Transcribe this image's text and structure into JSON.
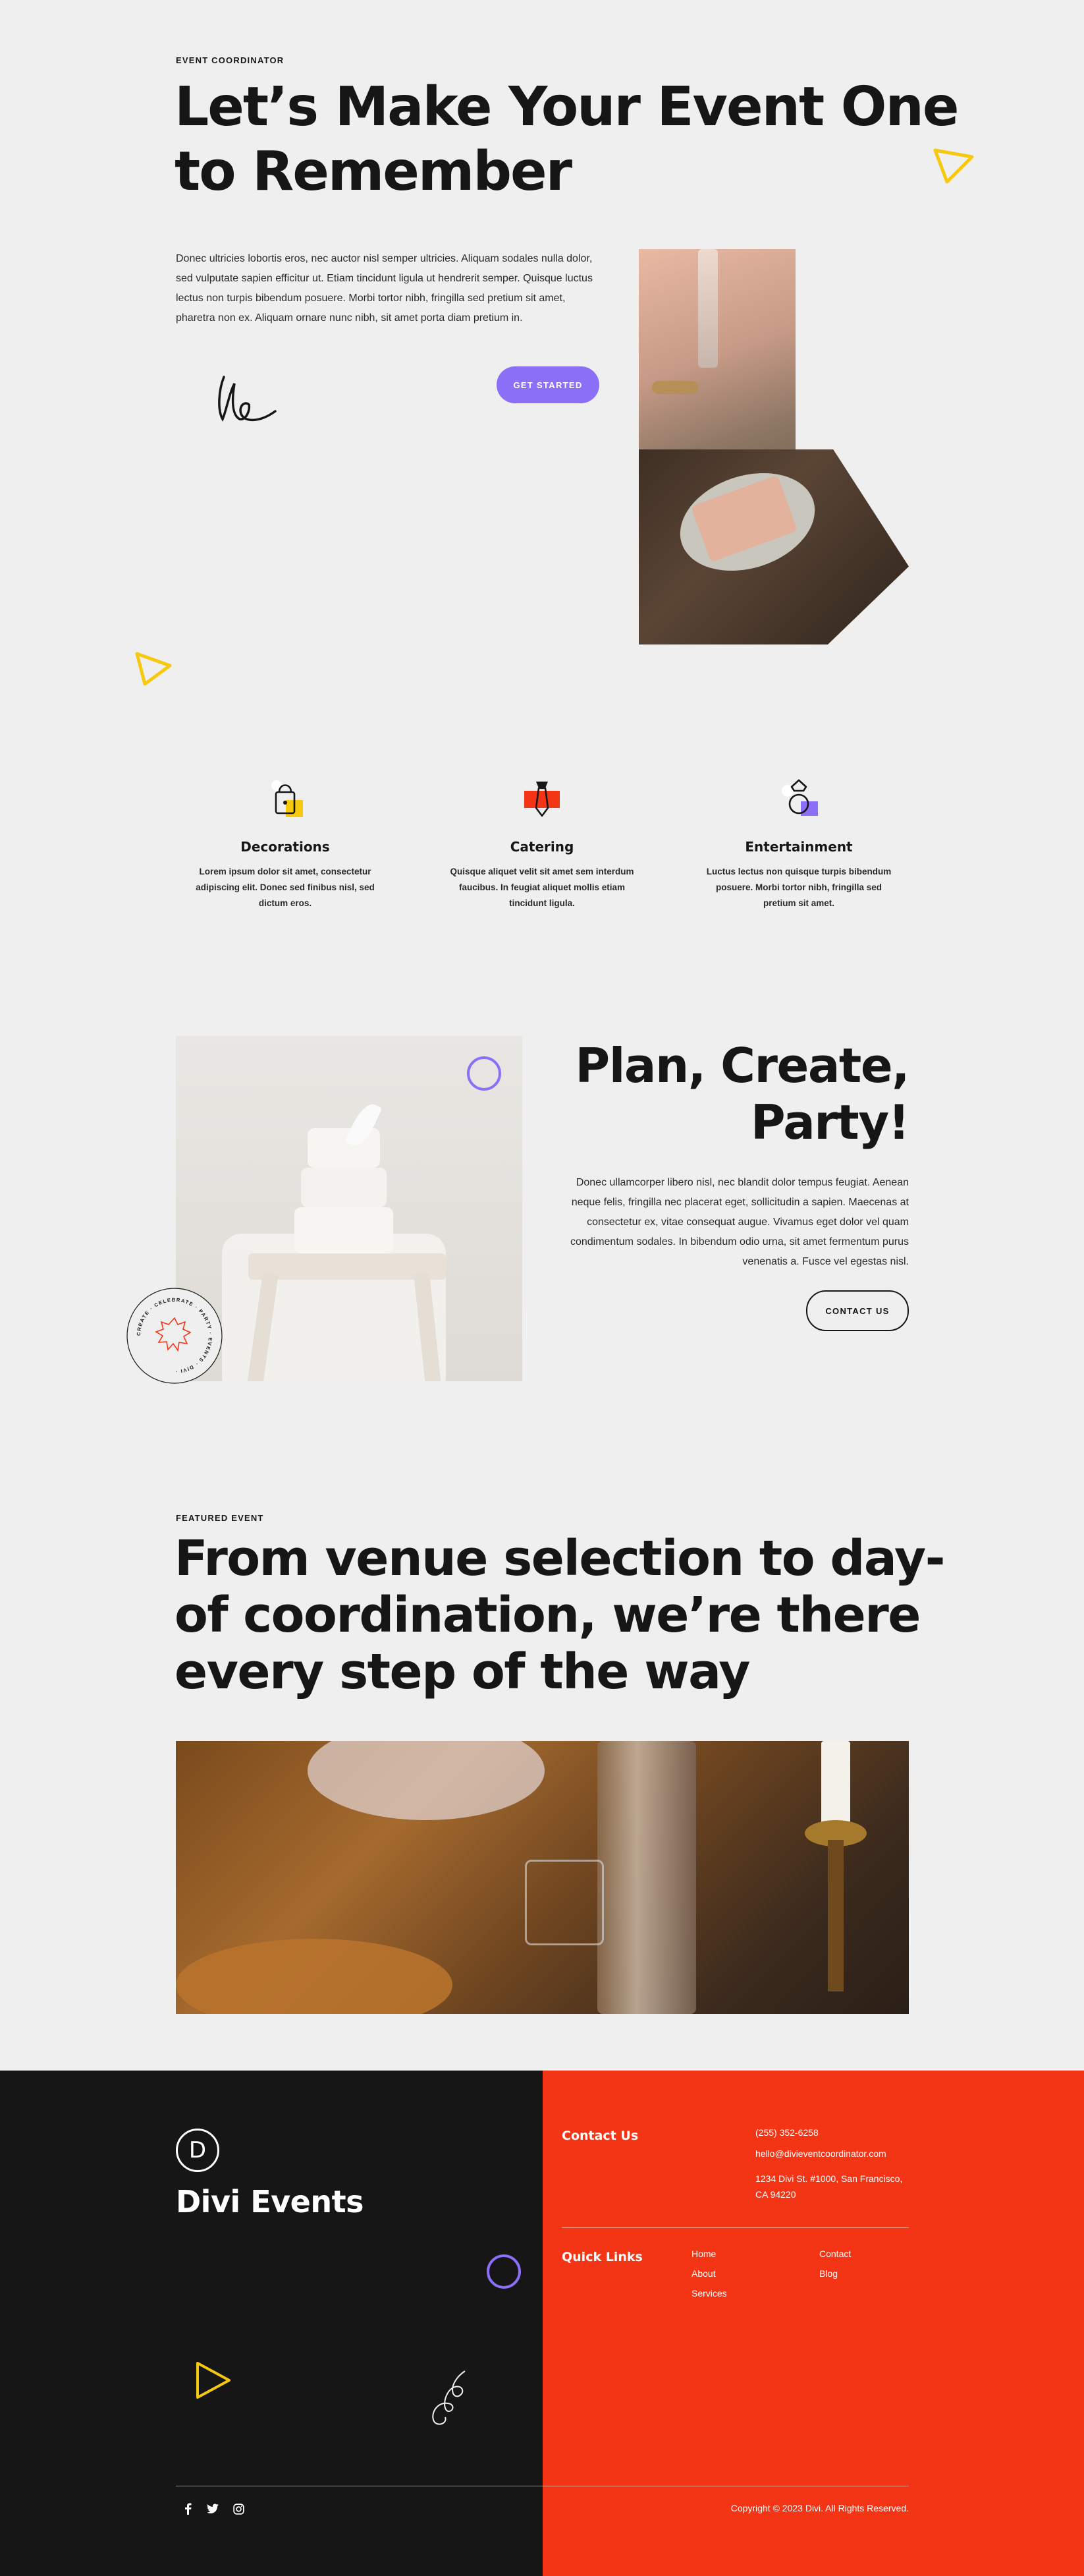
{
  "hero": {
    "eyebrow": "EVENT COORDINATOR",
    "title_line1": "Let’s Make Your Event One",
    "title_line2": "to Remember",
    "paragraph": "Donec ultricies lobortis eros, nec auctor nisl semper ultricies. Aliquam sodales nulla dolor, sed vulputate sapien efficitur ut. Etiam tincidunt ligula ut hendrerit semper. Quisque luctus lectus non turpis bibendum posuere. Morbi tortor nibh, fringilla sed pretium sit amet, pharetra non ex. Aliquam ornare nunc nibh, sit amet porta diam pretium in.",
    "cta_label": "GET STARTED"
  },
  "services": [
    {
      "title": "Decorations",
      "desc": "Lorem ipsum dolor sit amet, consectetur adipiscing elit. Donec sed finibus nisl, sed dictum eros.",
      "icon": "lock-bag-icon",
      "accent": "#f6c90e"
    },
    {
      "title": "Catering",
      "desc": "Quisque aliquet velit sit amet sem interdum faucibus. In feugiat aliquet mollis etiam tincidunt ligula.",
      "icon": "tie-icon",
      "accent": "#f33516"
    },
    {
      "title": "Entertainment",
      "desc": "Luctus lectus non quisque turpis bibendum posuere. Morbi tortor nibh, fringilla sed pretium sit amet.",
      "icon": "ring-icon",
      "accent": "#8c6ff7"
    }
  ],
  "plan": {
    "title_line1": "Plan, Create,",
    "title_line2": "Party!",
    "paragraph": "Donec ullamcorper libero nisl, nec blandit dolor tempus feugiat. Aenean neque felis, fringilla nec placerat eget, sollicitudin a sapien. Maecenas at consectetur ex, vitae consequat augue. Vivamus eget dolor vel quam condimentum sodales. In bibendum odio urna, sit amet fermentum purus venenatis a. Fusce vel egestas nisl.",
    "cta_label": "CONTACT US",
    "badge_text": "CREATE · CELEBRATE · PARTY · EVENTS · DIVI · "
  },
  "featured": {
    "eyebrow": "FEATURED EVENT",
    "title_line1": "From venue selection to day-",
    "title_line2": "of coordination, we’re there",
    "title_line3": "every step of the way"
  },
  "footer": {
    "logo_letter": "D",
    "brand": "Divi Events",
    "contact_heading": "Contact Us",
    "phone": "(255) 352-6258",
    "email": "hello@divieventcoordinator.com",
    "address_line1": "1234 Divi St. #1000, San Francisco,",
    "address_line2": "CA 94220",
    "quick_links_heading": "Quick Links",
    "links_col1": [
      "Home",
      "About",
      "Services"
    ],
    "links_col2": [
      "Contact",
      "Blog"
    ],
    "copyright": "Copyright © 2023 Divi. All Rights Reserved.",
    "social": [
      "f",
      "t",
      "ig"
    ]
  },
  "colors": {
    "purple": "#8c6ff7",
    "yellow": "#f6c90e",
    "red": "#f33516",
    "dark": "#161616",
    "bg": "#efefef"
  }
}
